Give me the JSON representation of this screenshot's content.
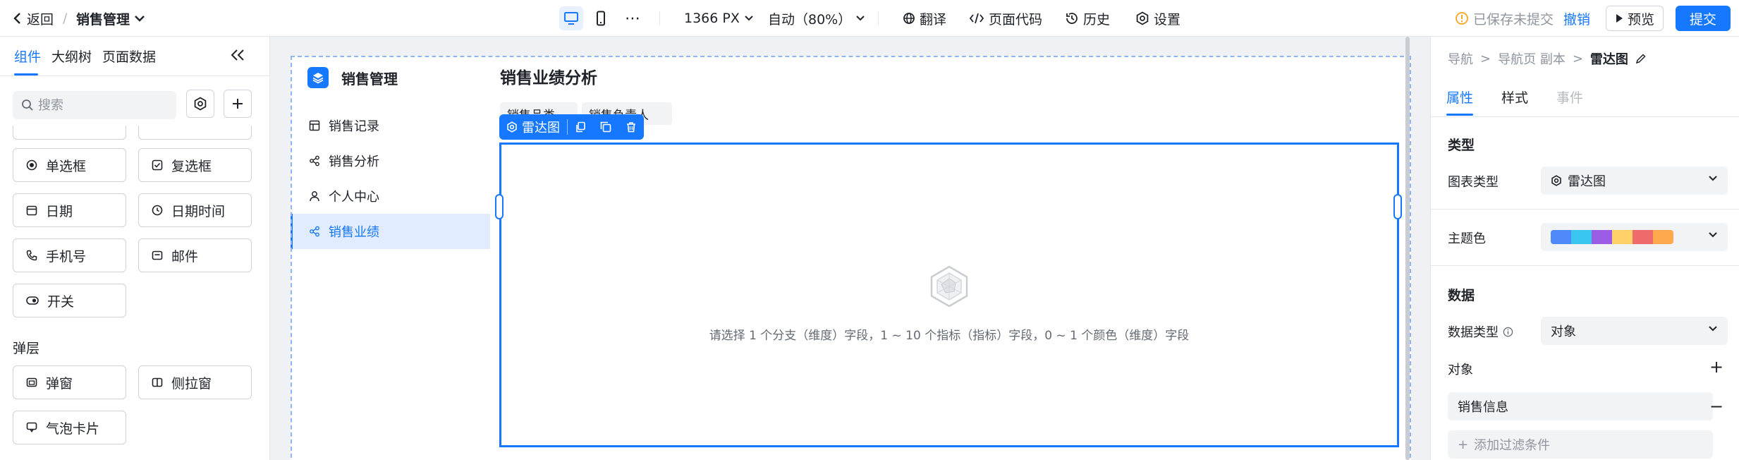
{
  "topbar": {
    "back_label": "返回",
    "breadcrumb_sep": "/",
    "page_name": "销售管理",
    "more_glyph": "⋯",
    "screen_width": "1366 PX",
    "zoom_label": "自动（80%）",
    "translate_label": "翻译",
    "code_label": "页面代码",
    "history_label": "历史",
    "settings_label": "设置",
    "unsaved_status": "已保存未提交",
    "revoke_label": "撤销",
    "preview_label": "预览",
    "submit_label": "提交"
  },
  "left_panel": {
    "tabs": [
      {
        "label": "组件",
        "active": true
      },
      {
        "label": "大纲树",
        "active": false
      },
      {
        "label": "页面数据",
        "active": false
      }
    ],
    "search_placeholder": "搜索",
    "components": [
      {
        "label": "单选框",
        "icon": "radio-icon"
      },
      {
        "label": "复选框",
        "icon": "checkbox-icon"
      },
      {
        "label": "日期",
        "icon": "calendar-icon"
      },
      {
        "label": "日期时间",
        "icon": "clock-icon"
      },
      {
        "label": "手机号",
        "icon": "phone-icon"
      },
      {
        "label": "邮件",
        "icon": "mail-icon"
      },
      {
        "label": "开关",
        "icon": "toggle-icon"
      }
    ],
    "layer_section_title": "弹层",
    "layer_components": [
      {
        "label": "弹窗",
        "icon": "modal-icon"
      },
      {
        "label": "侧拉窗",
        "icon": "drawer-icon"
      },
      {
        "label": "气泡卡片",
        "icon": "popover-icon"
      }
    ]
  },
  "canvas": {
    "app_nav": {
      "brand": "销售管理",
      "items": [
        {
          "label": "销售记录",
          "icon": "table-icon",
          "active": false
        },
        {
          "label": "销售分析",
          "icon": "share-icon",
          "active": false
        },
        {
          "label": "个人中心",
          "icon": "user-icon",
          "active": false
        },
        {
          "label": "销售业绩",
          "icon": "share-icon",
          "active": true
        }
      ]
    },
    "content_title": "销售业绩分析",
    "filters": [
      {
        "label": "销售品类"
      },
      {
        "label": "销售负责人"
      }
    ],
    "selection_toolbar": {
      "component_label": "雷达图"
    },
    "chart": {
      "empty_message": "请选择 1 个分支（维度）字段，1 ~ 10 个指标（指标）字段，0 ~ 1 个颜色（维度）字段"
    }
  },
  "right_panel": {
    "breadcrumb": [
      "导航",
      "导航页 副本",
      "雷达图"
    ],
    "crumb_sep": ">",
    "tabs": [
      {
        "label": "属性",
        "state": "active"
      },
      {
        "label": "样式",
        "state": "normal"
      },
      {
        "label": "事件",
        "state": "disabled"
      }
    ],
    "type_section": "类型",
    "chart_type_label": "图表类型",
    "chart_type_value": "雷达图",
    "theme_label": "主题色",
    "theme_colors": [
      "#4e8af9",
      "#38c5f0",
      "#9b5de5",
      "#ffd166",
      "#ef6b6b",
      "#ffa94d"
    ],
    "data_section": "数据",
    "data_type_label": "数据类型",
    "data_type_value": "对象",
    "object_label": "对象",
    "object_field": "销售信息",
    "add_filter_label": "添加过滤条件",
    "plus_glyph": "+",
    "minus_glyph": "−"
  },
  "colors": {
    "accent": "#1677ff",
    "warning": "#f5a623",
    "nav_active_bg": "#e1ecfe",
    "canvas_bg": "#f0f1f4"
  }
}
